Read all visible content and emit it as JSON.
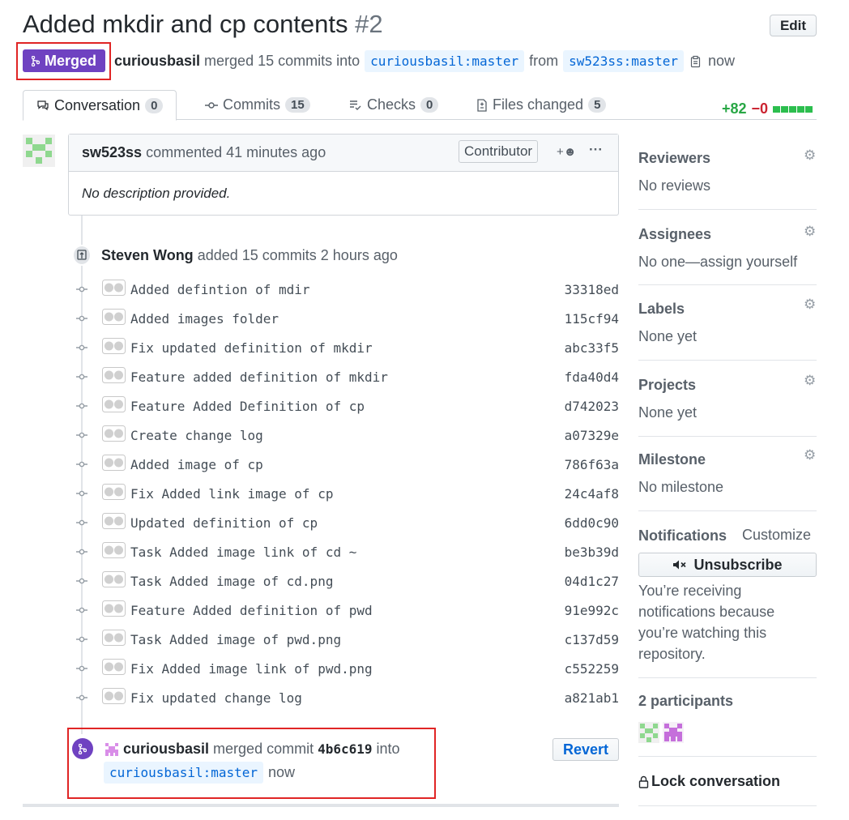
{
  "header": {
    "title": "Added mkdir and cp contents",
    "number": "#2",
    "edit_label": "Edit",
    "state_label": "Merged",
    "author": "curiousbasil",
    "merged_text": "merged 15 commits into",
    "base_branch": "curiousbasil:master",
    "from_text": "from",
    "head_branch": "sw523ss:master",
    "time": "now"
  },
  "tabs": [
    {
      "label": "Conversation",
      "count": "0"
    },
    {
      "label": "Commits",
      "count": "15"
    },
    {
      "label": "Checks",
      "count": "0"
    },
    {
      "label": "Files changed",
      "count": "5"
    }
  ],
  "diffstat": {
    "additions": "+82",
    "deletions": "−0"
  },
  "comment": {
    "author": "sw523ss",
    "action": "commented 41 minutes ago",
    "role": "Contributor",
    "body": "No description provided."
  },
  "commits_event": {
    "author": "Steven Wong",
    "action": "added 15 commits 2 hours ago"
  },
  "commits": [
    {
      "message": "Added defintion of mdir",
      "sha": "33318ed"
    },
    {
      "message": "Added images folder",
      "sha": "115cf94"
    },
    {
      "message": "Fix updated definition of mkdir",
      "sha": "abc33f5"
    },
    {
      "message": "Feature added definition of mkdir",
      "sha": "fda40d4"
    },
    {
      "message": "Feature Added Definition of cp",
      "sha": "d742023"
    },
    {
      "message": "Create change log",
      "sha": "a07329e"
    },
    {
      "message": "Added image of cp",
      "sha": "786f63a"
    },
    {
      "message": "Fix Added link image of cp",
      "sha": "24c4af8"
    },
    {
      "message": "Updated definition of cp",
      "sha": "6dd0c90"
    },
    {
      "message": "Task Added image link of cd ~",
      "sha": "be3b39d"
    },
    {
      "message": "Task Added image of cd.png",
      "sha": "04d1c27"
    },
    {
      "message": "Feature Added definition of pwd",
      "sha": "91e992c"
    },
    {
      "message": "Task Added image of pwd.png",
      "sha": "c137d59"
    },
    {
      "message": "Fix Added image link of pwd.png",
      "sha": "c552259"
    },
    {
      "message": "Fix updated change log",
      "sha": "a821ab1"
    }
  ],
  "merge_event": {
    "author": "curiousbasil",
    "action": "merged commit",
    "sha": "4b6c619",
    "into": "into",
    "branch": "curiousbasil:master",
    "time": "now",
    "revert_label": "Revert"
  },
  "sidebar": {
    "reviewers": {
      "title": "Reviewers",
      "value": "No reviews"
    },
    "assignees": {
      "title": "Assignees",
      "value": "No one—assign yourself"
    },
    "labels": {
      "title": "Labels",
      "value": "None yet"
    },
    "projects": {
      "title": "Projects",
      "value": "None yet"
    },
    "milestone": {
      "title": "Milestone",
      "value": "No milestone"
    },
    "notifications": {
      "title": "Notifications",
      "customize": "Customize",
      "unsubscribe_label": "Unsubscribe",
      "description": "You’re receiving notifications because you’re watching this repository."
    },
    "participants_title": "2 participants",
    "lock_label": "Lock conversation"
  },
  "colors": {
    "merged_purple": "#6f42c1",
    "link_blue": "#0366d6",
    "addition_green": "#28a745",
    "deletion_red": "#cb2431",
    "highlight_red": "#e02525"
  }
}
